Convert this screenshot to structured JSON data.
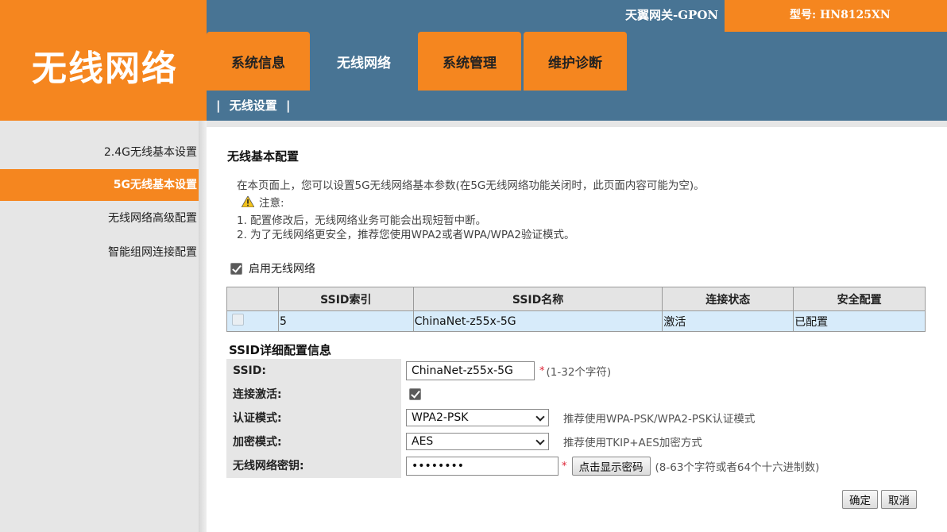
{
  "header": {
    "logo_text": "无线网络",
    "brand": "天翼网关-GPON",
    "model": "型号: HN8125XN",
    "tabs": [
      {
        "label": "系统信息",
        "active": false
      },
      {
        "label": "无线网络",
        "active": true
      },
      {
        "label": "系统管理",
        "active": false
      },
      {
        "label": "维护诊断",
        "active": false
      }
    ],
    "subnav": {
      "label": "无线设置",
      "left_sep": "|",
      "right_sep": "|"
    },
    "colors": {
      "orange": "#f5861f",
      "blue": "#487494"
    }
  },
  "sidebar": {
    "items": [
      {
        "label": "2.4G无线基本设置",
        "active": false
      },
      {
        "label": "5G无线基本设置",
        "active": true
      },
      {
        "label": "无线网络高级配置",
        "active": false
      },
      {
        "label": "智能组网连接配置",
        "active": false
      }
    ]
  },
  "main": {
    "title": "无线基本配置",
    "description": "在本页面上，您可以设置5G无线网络基本参数(在5G无线网络功能关闭时，此页面内容可能为空)。",
    "note_label": "注意:",
    "warning_icon": "warning-icon",
    "tips": [
      "1. 配置修改后，无线网络业务可能会出现短暂中断。",
      "2. 为了无线网络更安全，推荐您使用WPA2或者WPA/WPA2验证模式。"
    ],
    "enable_label": "启用无线网络",
    "enable_checked": true,
    "table": {
      "headers": [
        "",
        "SSID索引",
        "SSID名称",
        "连接状态",
        "安全配置"
      ],
      "rows": [
        {
          "index": "5",
          "name": "ChinaNet-z55x-5G",
          "status": "激活",
          "security": "已配置"
        }
      ]
    },
    "detail_title": "SSID详细配置信息",
    "form": {
      "ssid_label": "SSID:",
      "ssid_value": "ChinaNet-z55x-5G",
      "ssid_star": "*",
      "ssid_hint": "(1-32个字符)",
      "active_label": "连接激活:",
      "active_checked": true,
      "auth_label": "认证模式:",
      "auth_value": "WPA2-PSK",
      "auth_hint": "推荐使用WPA-PSK/WPA2-PSK认证模式",
      "enc_label": "加密模式:",
      "enc_value": "AES",
      "enc_hint": "推荐使用TKIP+AES加密方式",
      "key_label": "无线网络密钥:",
      "key_value": "••••••••",
      "key_star": "*",
      "show_key_button": "点击显示密码",
      "key_hint": "(8-63个字符或者64个十六进制数)"
    },
    "buttons": {
      "ok": "确定",
      "cancel": "取消"
    }
  }
}
